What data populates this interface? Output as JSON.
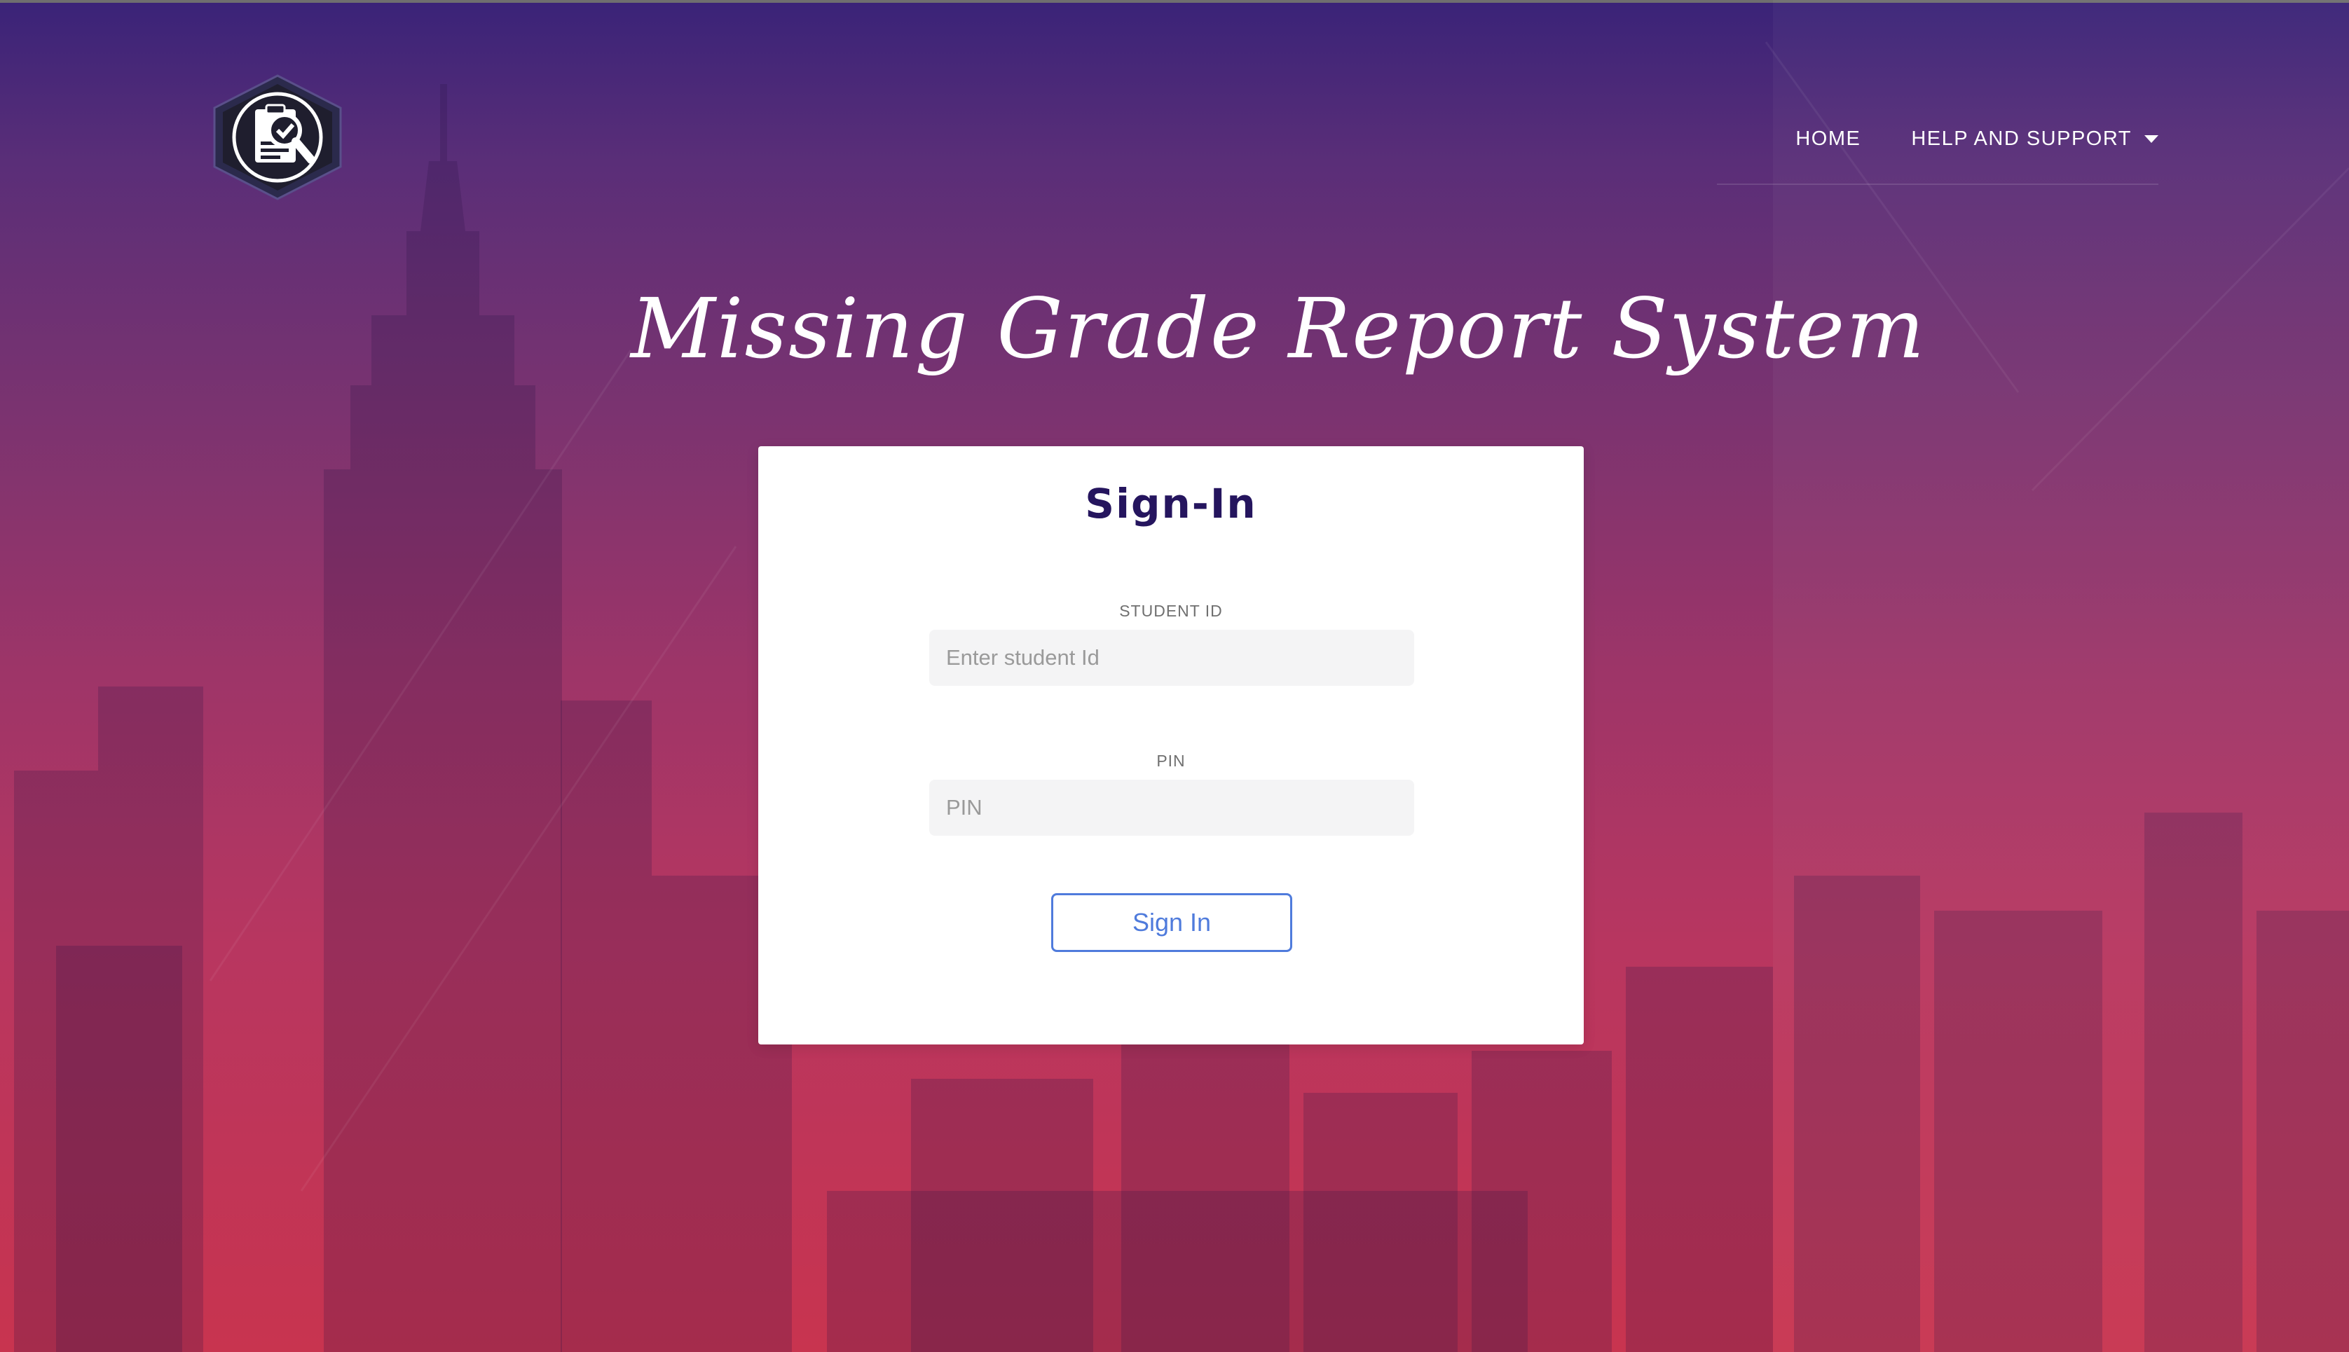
{
  "nav": {
    "home_label": "HOME",
    "help_label": "HELP AND SUPPORT"
  },
  "hero": {
    "title": "Missing Grade Report System"
  },
  "signin": {
    "heading": "Sign-In",
    "student_id_label": "STUDENT ID",
    "student_id_placeholder": "Enter student Id",
    "student_id_value": "",
    "pin_label": "PIN",
    "pin_placeholder": "PIN",
    "pin_value": "",
    "button_label": "Sign In"
  },
  "colors": {
    "gradient_top": "#3a2378",
    "gradient_bottom": "#c8344f",
    "heading_color": "#25155e",
    "button_accent": "#4f7bdc"
  },
  "icons": {
    "logo": "clipboard-magnifier-hexagon-logo",
    "dropdown": "caret-down-icon"
  }
}
